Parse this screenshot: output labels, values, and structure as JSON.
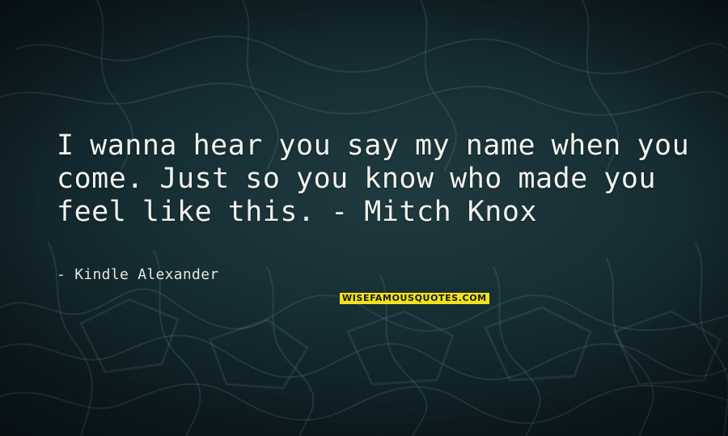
{
  "quote": {
    "text": "I wanna hear you say my name when you come. Just so you know who made you feel like this. - Mitch Knox",
    "author": "- Kindle Alexander"
  },
  "watermark": {
    "text": "WISEFAMOUSQUOTES.COM"
  },
  "colors": {
    "background": "#173035",
    "text": "#f2f2ee",
    "watermark_bg": "#f2e21a"
  }
}
